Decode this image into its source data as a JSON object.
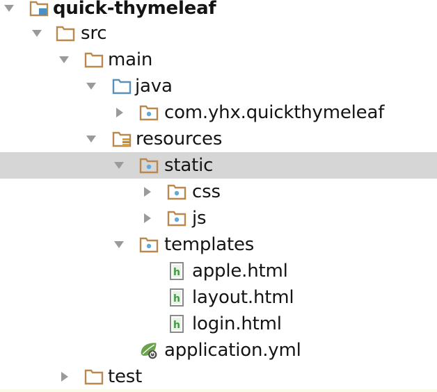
{
  "project_tree": {
    "items": [
      {
        "label": "quick-thymeleaf",
        "state": "expanded",
        "icon": "project-folder-icon"
      },
      {
        "label": "src",
        "state": "expanded",
        "icon": "folder-icon"
      },
      {
        "label": "main",
        "state": "expanded",
        "icon": "folder-icon"
      },
      {
        "label": "java",
        "state": "expanded",
        "icon": "source-root-folder-icon"
      },
      {
        "label": "com.yhx.quickthymeleaf",
        "state": "collapsed",
        "icon": "package-folder-icon"
      },
      {
        "label": "resources",
        "state": "expanded",
        "icon": "resources-folder-icon"
      },
      {
        "label": "static",
        "state": "expanded",
        "icon": "package-folder-icon",
        "selected": true
      },
      {
        "label": "css",
        "state": "collapsed",
        "icon": "package-folder-icon"
      },
      {
        "label": "js",
        "state": "collapsed",
        "icon": "package-folder-icon"
      },
      {
        "label": "templates",
        "state": "expanded",
        "icon": "package-folder-icon"
      },
      {
        "label": "apple.html",
        "icon": "html-file-icon"
      },
      {
        "label": "layout.html",
        "icon": "html-file-icon"
      },
      {
        "label": "login.html",
        "icon": "html-file-icon"
      },
      {
        "label": "application.yml",
        "icon": "spring-yml-icon"
      },
      {
        "label": "test",
        "state": "collapsed",
        "icon": "folder-icon"
      }
    ]
  },
  "colors": {
    "folder": "#b9884f",
    "source_folder": "#5a8fb8",
    "package_dot": "#62a8da",
    "selection": "#d6d6d6",
    "arrow": "#9a9a9a",
    "html_green": "#3e9d3e",
    "spring_green": "#6aa34c"
  }
}
